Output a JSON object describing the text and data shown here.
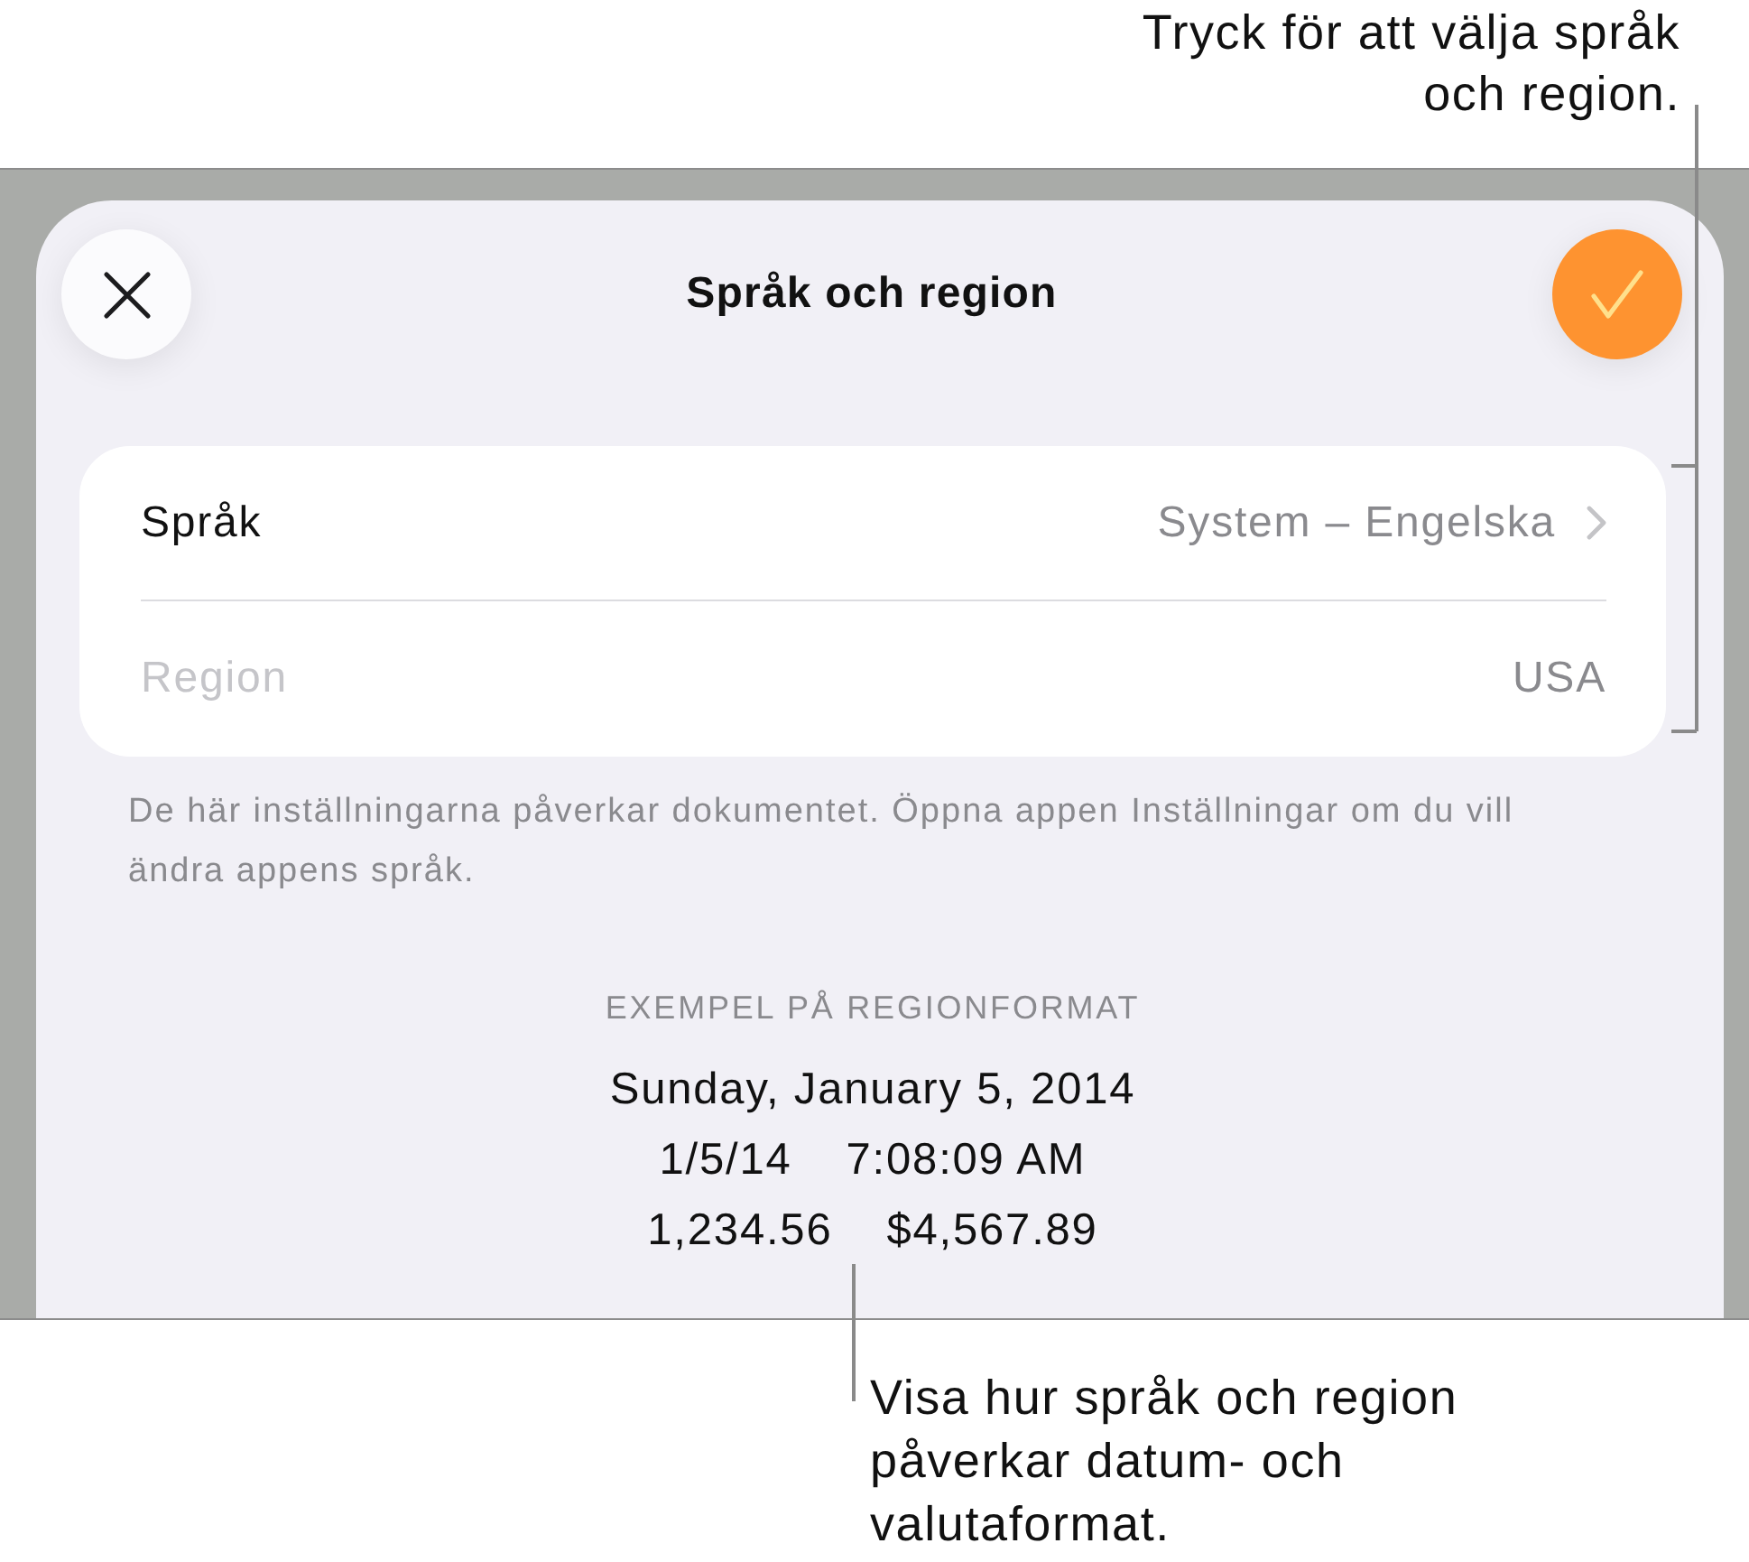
{
  "callout_top": {
    "text": "Tryck för att välja språk och region."
  },
  "sheet": {
    "title": "Språk och region",
    "rows": [
      {
        "kind": "navigation",
        "label": "Språk",
        "value": "System – Engelska",
        "disabled": false
      },
      {
        "kind": "static",
        "label": "Region",
        "value": "USA",
        "disabled": true
      }
    ],
    "footnote": "De här inställningarna påverkar dokumentet. Öppna appen Inställningar om du vill ändra appens språk.",
    "example": {
      "heading": "EXEMPEL PÅ REGIONFORMAT",
      "lines": [
        [
          "Sunday, January 5, 2014"
        ],
        [
          "1/5/14",
          "7:08:09 AM"
        ],
        [
          "1,234.56",
          "$4,567.89"
        ]
      ]
    }
  },
  "callout_bottom": {
    "text": "Visa hur språk och region påverkar datum- och valutaformat."
  }
}
